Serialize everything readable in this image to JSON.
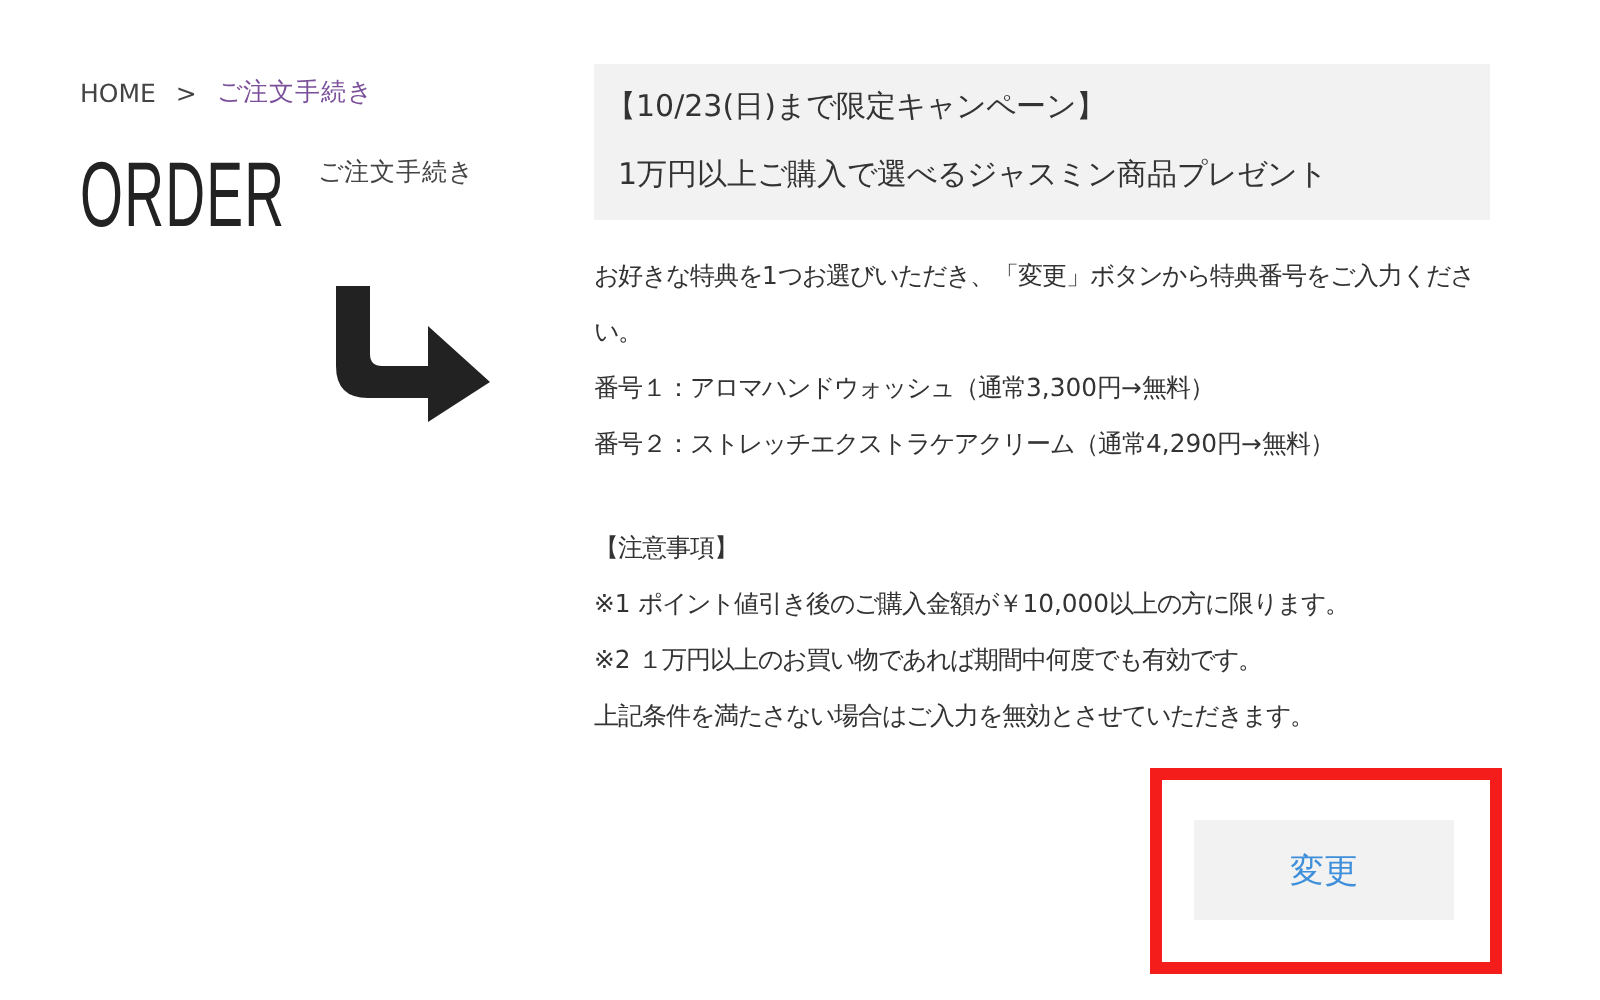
{
  "breadcrumb": [
    {
      "label": "HOME",
      "current": false
    },
    {
      "label": "ご注文手続き",
      "current": true
    }
  ],
  "breadcrumb_separator": ">",
  "heading": {
    "title": "ORDER",
    "subtitle": "ご注文手続き"
  },
  "banner": [
    "【10/23(日)まで限定キャンペーン】",
    "1万円以上ご購入で選べるジャスミン商品プレゼント"
  ],
  "description": [
    "お好きな特典を1つお選びいただき、「変更」ボタンから特典番号をご入力ください。",
    "番号１：アロマハンドウォッシュ（通常3,300円→無料）",
    "番号２：ストレッチエクストラケアクリーム（通常4,290円→無料）"
  ],
  "notes": [
    "【注意事項】",
    "※1 ポイント値引き後のご購入金額が￥10,000以上の方に限ります。",
    "※2 １万円以上のお買い物であれば期間中何度でも有効です。",
    "上記条件を満たさない場合はご入力を無効とさせていただきます。"
  ],
  "button": {
    "label": "変更",
    "highlighted": true
  }
}
